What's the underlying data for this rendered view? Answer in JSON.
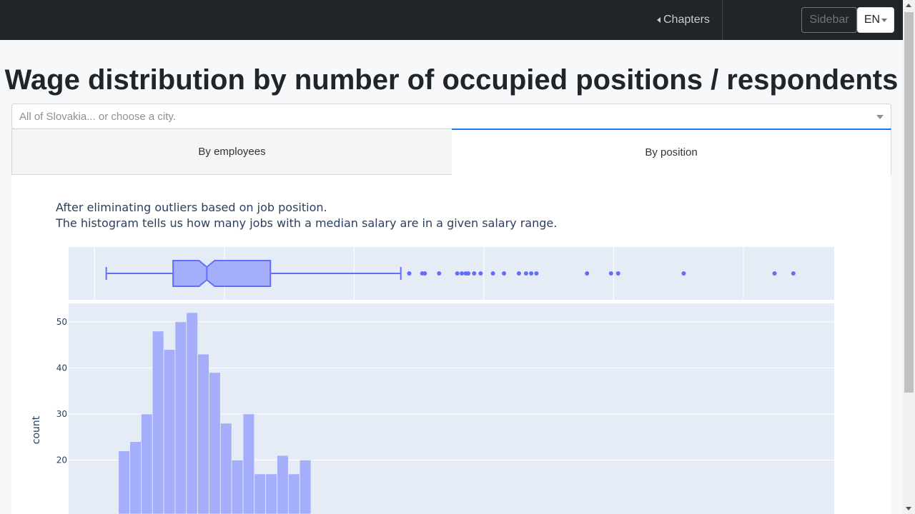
{
  "navbar": {
    "chapters_label": "Chapters",
    "sidebar_label": "Sidebar",
    "lang_label": "EN"
  },
  "page": {
    "title": "Wage distribution by number of occupied positions / respondents"
  },
  "city_select": {
    "placeholder": "All of Slovakia... or choose a city."
  },
  "tabs": [
    {
      "label": "By employees",
      "selected": false
    },
    {
      "label": "By position",
      "selected": true
    }
  ],
  "description": {
    "line1": "After eliminating outliers based on job position.",
    "line2": "The histogram tells us how many jobs with a median salary are in a given salary range."
  },
  "colors": {
    "accent": "#1975fa",
    "plot_bg": "#e5ecf6",
    "bar_fill": "#a4aefa",
    "box_stroke": "#636efa",
    "box_fill": "#a4aefa"
  },
  "chart_data": [
    {
      "type": "box",
      "orientation": "horizontal",
      "boxplot": {
        "whisker_low": 0.18,
        "q1": 1.21,
        "median": 1.73,
        "q3": 2.71,
        "whisker_high": 4.72,
        "notch_low": 1.61,
        "notch_high": 1.85
      },
      "outliers": [
        4.85,
        5.05,
        5.09,
        5.31,
        5.59,
        5.66,
        5.72,
        5.76,
        5.85,
        5.95,
        6.14,
        6.31,
        6.54,
        6.65,
        6.73,
        6.81,
        7.59,
        7.96,
        8.07,
        9.08,
        10.48,
        10.77
      ],
      "xlim": [
        -0.4,
        11.4
      ],
      "grid": true
    },
    {
      "type": "bar",
      "x_bins": [
        0.5,
        1.5,
        2.5,
        3.5,
        4.5,
        5.5,
        6.5,
        7.5,
        8.5,
        9.5,
        10.5,
        11.5,
        12.5,
        13.5,
        14.5,
        15.5,
        16.5
      ],
      "values": [
        22,
        24,
        30,
        48,
        44,
        50,
        52,
        43,
        39,
        28,
        20,
        30,
        17,
        17,
        21,
        17,
        20
      ],
      "ylabel": "count",
      "yticks": [
        20,
        30,
        40,
        50
      ],
      "ylim": [
        8.3,
        54
      ],
      "xlim": [
        -4.4,
        63.2
      ],
      "grid": true
    }
  ]
}
